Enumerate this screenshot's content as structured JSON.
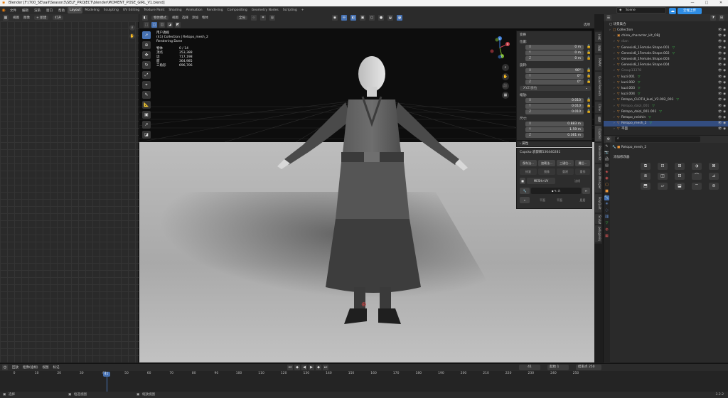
{
  "window": {
    "title": "Blender [F:\\700_SE\\sail\\Season3\\SELF_PROJECT\\blender\\MOMENT_POSE_GIRL_V1.blend]",
    "controls": [
      "—",
      "□",
      "✕"
    ]
  },
  "menu": [
    "文件",
    "编辑",
    "渲染",
    "窗口",
    "帮助"
  ],
  "workspaces": [
    "Layout",
    "Modeling",
    "Sculpting",
    "UV Editing",
    "Texture Paint",
    "Shading",
    "Animation",
    "Rendering",
    "Compositing",
    "Geometry Nodes",
    "Scripting"
  ],
  "active_workspace": "Layout",
  "add_tab": "+",
  "scene": {
    "name": "Scene"
  },
  "upload_button": "云端上传",
  "left_editor": {
    "header": [
      "视图",
      "图像",
      "+ 新建",
      "打开"
    ]
  },
  "viewport": {
    "header_row1": [
      "物体模式",
      "视图",
      "选择",
      "添加",
      "物体"
    ],
    "transform": "全局",
    "options_label": "选项",
    "overlay": {
      "mode": "用户透视",
      "collection": "(41) Collection | Retopo_mesh_2",
      "render_status": "Rendering Done",
      "stats": [
        {
          "label": "物体",
          "value": "0 / 14"
        },
        {
          "label": "顶点",
          "value": "353,388"
        },
        {
          "label": "边",
          "value": "717,198"
        },
        {
          "label": "面",
          "value": "364,985"
        },
        {
          "label": "三角形",
          "value": "696,706"
        }
      ]
    },
    "gizmo": {
      "x": "X",
      "y": "Y",
      "z": "Z"
    }
  },
  "npanel": {
    "section_transform": "变换",
    "location_label": "位置:",
    "location": [
      {
        "k": "X",
        "v": "0 m"
      },
      {
        "k": "Y",
        "v": "0 m"
      },
      {
        "k": "Z",
        "v": "0 m"
      }
    ],
    "rotation_label": "旋转:",
    "rotation": [
      {
        "k": "X",
        "v": "90°"
      },
      {
        "k": "Y",
        "v": "0°"
      },
      {
        "k": "Z",
        "v": "0°"
      }
    ],
    "rotation_mode": "XYZ 欧拉",
    "scale_label": "缩放:",
    "scale": [
      {
        "k": "X",
        "v": "0.010"
      },
      {
        "k": "Y",
        "v": "0.010"
      },
      {
        "k": "Z",
        "v": "0.010"
      }
    ],
    "dimensions_label": "尺寸:",
    "dimensions": [
      {
        "k": "X",
        "v": "0.883 m"
      },
      {
        "k": "Y",
        "v": "1.59 m"
      },
      {
        "k": "Z",
        "v": "0.361 m"
      }
    ],
    "section_props": "属性"
  },
  "cupcko": {
    "title": "Cupcko:哀骤瞬536440281",
    "buttons": [
      "保存法...",
      "加载法...",
      "三键位...",
      "雕后...",
      "修复",
      "镜像",
      "重建",
      "重排"
    ],
    "mesh_label": "MESH>UV",
    "mesh_extra": "法线",
    "row3": [
      "平面",
      "平面",
      "居居"
    ]
  },
  "side_tabs": [
    "工具",
    "视图",
    "RMAX",
    "Quad Remesh",
    "Cline",
    "编辑",
    "Cupcko",
    "BlenderKit",
    "Node Wrangler",
    "PolyQuilt",
    "Sculpt",
    "polygoniq"
  ],
  "outliner": {
    "header_label": "场景集合",
    "rows": [
      {
        "name": "Collection",
        "indent": 0,
        "icon": "□",
        "mod": ""
      },
      {
        "name": "china_character_kit_OBJ",
        "indent": 1,
        "icon": "▣",
        "mod": ""
      },
      {
        "name": "dian",
        "indent": 1,
        "icon": "▽",
        "mod": "",
        "dim": true
      },
      {
        "name": "Genesis8_1Female.Shape.001",
        "indent": 1,
        "icon": "▽",
        "mod": "▽"
      },
      {
        "name": "Genesis8_1Female.Shape.002",
        "indent": 1,
        "icon": "▽",
        "mod": "▽"
      },
      {
        "name": "Genesis8_1Female.Shape.003",
        "indent": 1,
        "icon": "▽",
        "mod": ""
      },
      {
        "name": "Genesis8_1Female.Shape.004",
        "indent": 1,
        "icon": "▽",
        "mod": ""
      },
      {
        "name": "Group13378",
        "indent": 1,
        "icon": "▽",
        "mod": "",
        "dim": true
      },
      {
        "name": "kuzi.001",
        "indent": 1,
        "icon": "▽",
        "mod": "▽"
      },
      {
        "name": "kuzi.002",
        "indent": 1,
        "icon": "▽",
        "mod": "▽"
      },
      {
        "name": "kuzi.003",
        "indent": 1,
        "icon": "▽",
        "mod": "▽"
      },
      {
        "name": "kuzi.004",
        "indent": 1,
        "icon": "▽",
        "mod": "▽"
      },
      {
        "name": "Retopo_CLOTH_kuzi_V2.002_001",
        "indent": 1,
        "icon": "▽",
        "mod": "▽"
      },
      {
        "name": "Retopo_daizi_001",
        "indent": 1,
        "icon": "▽",
        "mod": "▽",
        "dim": true
      },
      {
        "name": "Retopo_daizi_001.001",
        "indent": 1,
        "icon": "▽",
        "mod": "▽"
      },
      {
        "name": "Retopo_neishin",
        "indent": 1,
        "icon": "▽",
        "mod": "▽"
      },
      {
        "name": "Retopo_mesh_2",
        "indent": 1,
        "icon": "▽",
        "mod": "▽"
      },
      {
        "name": "平面",
        "indent": 1,
        "icon": "▽",
        "mod": ""
      }
    ]
  },
  "properties": {
    "object_name": "Retopo_mesh_2",
    "add_modifier": "添加修改器"
  },
  "timeline": {
    "header": [
      "回放",
      "抠像(插帧)",
      "视图",
      "标记"
    ],
    "current_frame": "41",
    "start_label": "起始",
    "start": "1",
    "end_label": "结束点",
    "end": "250",
    "ticks": [
      "0",
      "10",
      "20",
      "30",
      "40",
      "50",
      "60",
      "70",
      "80",
      "90",
      "100",
      "110",
      "120",
      "130",
      "140",
      "150",
      "160",
      "170",
      "180",
      "190",
      "200",
      "210",
      "220",
      "230",
      "240",
      "250"
    ]
  },
  "status_bar": {
    "items": [
      "选择",
      "框选视图",
      "缩放视图"
    ],
    "version": "3.2.2"
  },
  "colors": {
    "accent": "#4772b3",
    "upload": "#2f8de4",
    "object_orange": "#e8953a",
    "modifier_green": "#3cc14a",
    "selection": "#334d80"
  }
}
